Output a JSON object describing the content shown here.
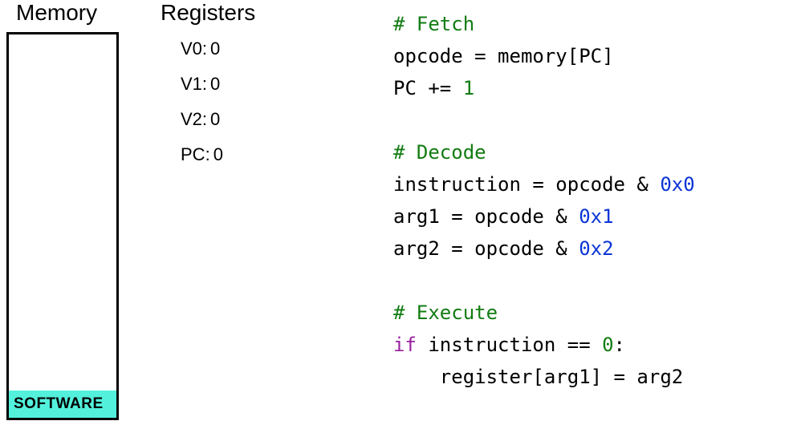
{
  "memory": {
    "title": "Memory",
    "software_label": "SOFTWARE"
  },
  "registers": {
    "title": "Registers",
    "rows": [
      {
        "name": "V0",
        "value": "0"
      },
      {
        "name": "V1",
        "value": "0"
      },
      {
        "name": "V2",
        "value": "0"
      },
      {
        "name": "PC",
        "value": "0"
      }
    ]
  },
  "code": {
    "lines": [
      {
        "type": "comment",
        "text": "# Fetch"
      },
      {
        "type": "plain",
        "text": "opcode = memory[PC]"
      },
      {
        "type": "inc",
        "prefix": "PC += ",
        "num": "1"
      },
      {
        "type": "blank"
      },
      {
        "type": "comment",
        "text": "# Decode"
      },
      {
        "type": "mask",
        "prefix": "instruction = opcode & ",
        "hex": "0x0"
      },
      {
        "type": "mask",
        "prefix": "arg1 = opcode & ",
        "hex": "0x1"
      },
      {
        "type": "mask",
        "prefix": "arg2 = opcode & ",
        "hex": "0x2"
      },
      {
        "type": "blank"
      },
      {
        "type": "comment",
        "text": "# Execute"
      },
      {
        "type": "if",
        "kw": "if",
        "mid": " instruction == ",
        "num": "0",
        "suffix": ":"
      },
      {
        "type": "plain",
        "text": "    register[arg1] = arg2"
      }
    ]
  }
}
